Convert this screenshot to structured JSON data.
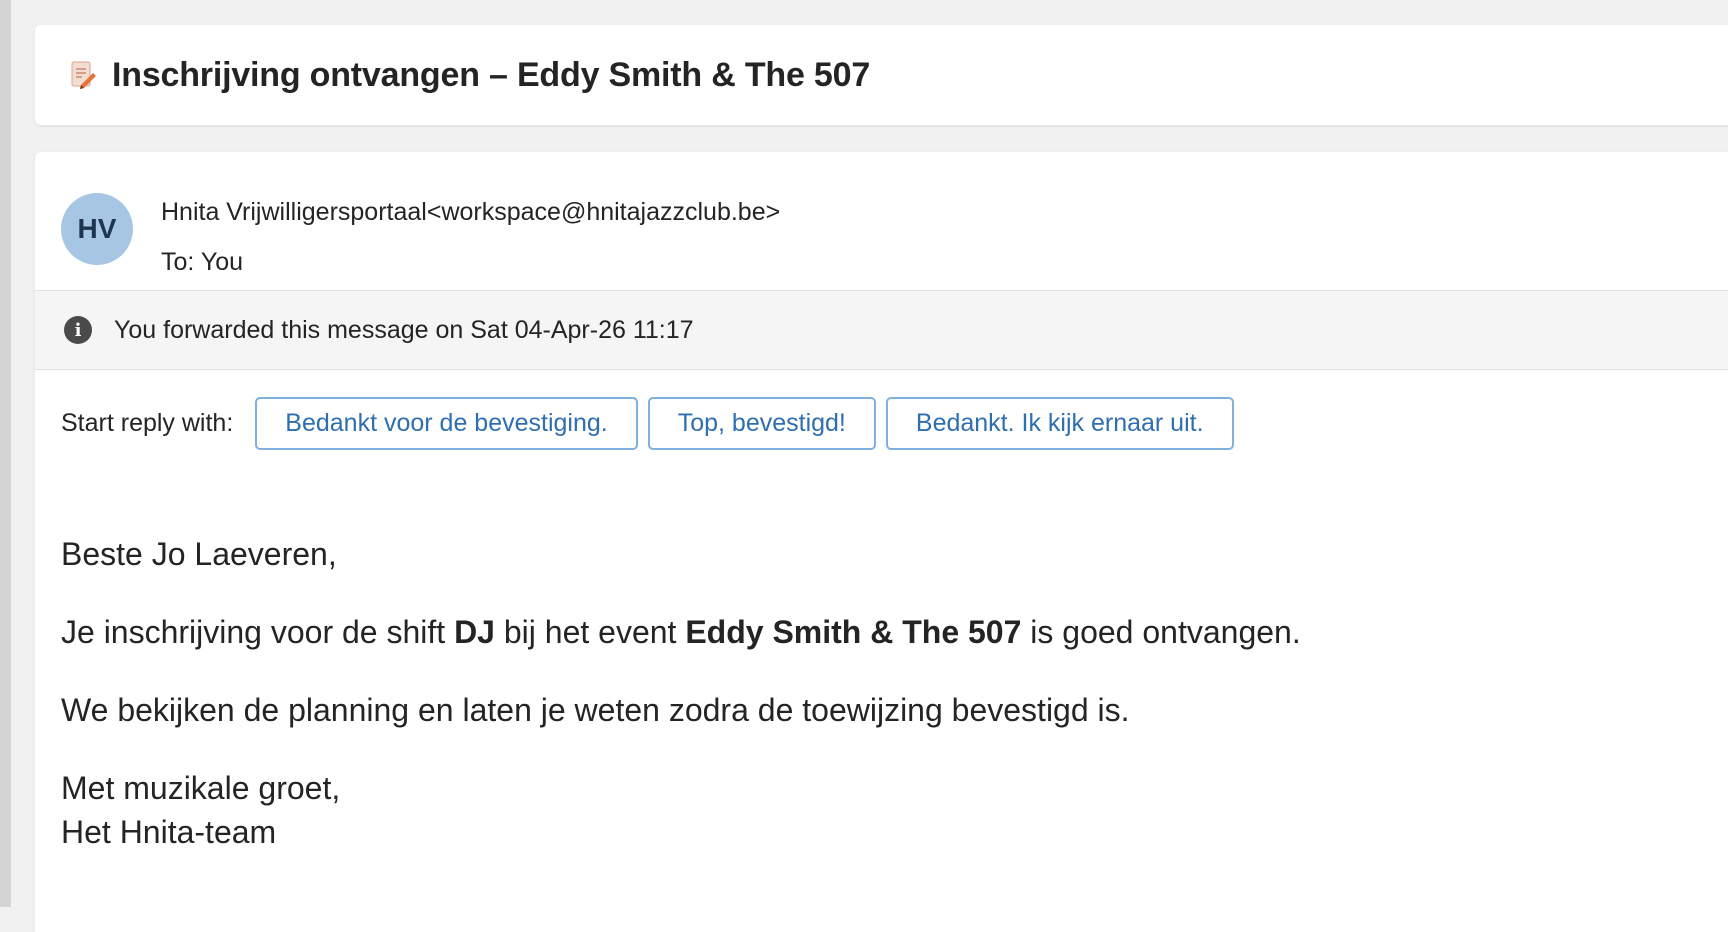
{
  "subject": {
    "icon": "edit-document-icon",
    "title": "Inschrijving ontvangen – Eddy Smith & The 507"
  },
  "message": {
    "avatar_initials": "HV",
    "sender_name": "Hnita Vrijwilligersportaal",
    "sender_email": "<workspace@hnitajazzclub.be>",
    "to_label": "To:",
    "to_value": "You",
    "info_icon": "info-icon",
    "info_text": "You forwarded this message on Sat 04-Apr-26 11:17",
    "reply_label": "Start reply with:",
    "quick_replies": [
      "Bedankt voor de bevestiging.",
      "Top, bevestigd!",
      "Bedankt. Ik kijk ernaar uit."
    ],
    "body": {
      "greeting": "Beste Jo Laeveren,",
      "line1_pre": "Je inschrijving voor de shift ",
      "line1_shift": "DJ",
      "line1_mid": " bij het event ",
      "line1_event": "Eddy Smith & The 507",
      "line1_post": " is goed ontvangen.",
      "line2": "We bekijken de planning en laten je weten zodra de toewijzing bevestigd is.",
      "closing": "Met muzikale groet,",
      "signature": "Het Hnita-team"
    }
  },
  "colors": {
    "avatar_bg": "#a7c6e3",
    "button_border": "#7fb0de",
    "button_text": "#2f6fb0"
  }
}
